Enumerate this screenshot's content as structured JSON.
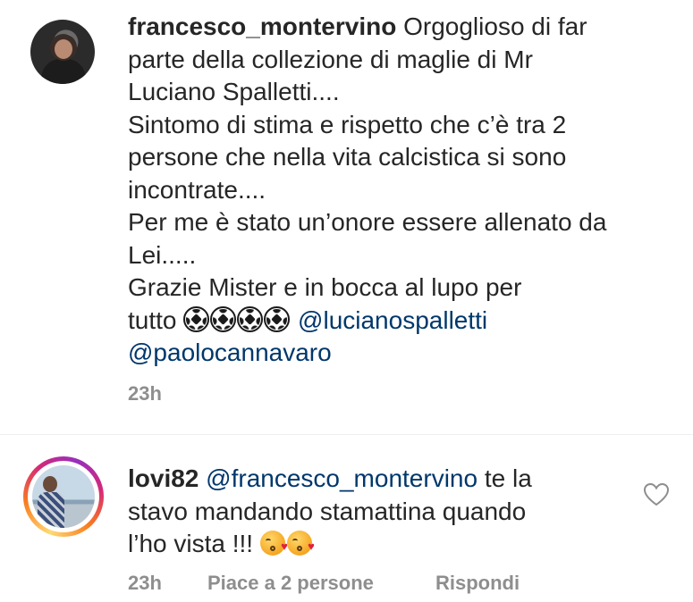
{
  "post": {
    "username": "francesco_montervino",
    "text_lines": [
      "Orgoglioso di far",
      "parte della collezione di maglie di Mr",
      "Luciano Spalletti....",
      "Sintomo di stima e rispetto che c’è tra 2",
      "persone che nella vita calcistica si sono",
      "incontrate....",
      "Per me è stato un’onore essere allenato da",
      "Lei.....",
      "Grazie Mister e in bocca al lupo per"
    ],
    "last_line_prefix": "tutto",
    "emoji_icon": "soccer-ball-icon",
    "emoji_count": 4,
    "mention_1": "@lucianospalletti",
    "mention_2": "@paolocannavaro",
    "time": "23h"
  },
  "reply": {
    "username": "lovi82",
    "mention": "@francesco_montervino",
    "text_line_1": "te la",
    "text_line_2": "stavo mandando stamattina quando",
    "text_line_3": "l’ho vista !!!",
    "emoji_icon": "kissing-face-heart-emoji",
    "emoji_count": 2,
    "time": "23h",
    "likes_label": "Piace a 2 persone",
    "reply_label": "Rispondi",
    "like_icon": "heart-outline-icon"
  },
  "colors": {
    "text": "#262626",
    "mention": "#00376b",
    "secondary": "#8e8e8e",
    "divider": "#efefef"
  }
}
